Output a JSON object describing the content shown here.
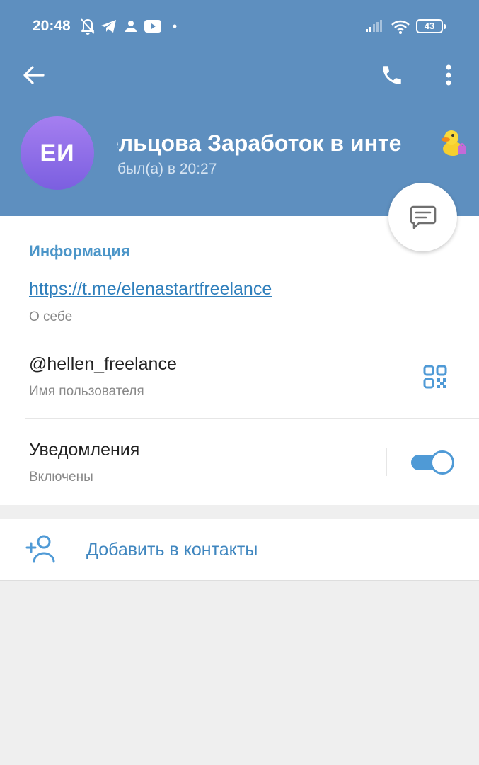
{
  "status_bar": {
    "time": "20:48",
    "battery": "43",
    "icons": [
      "bell-off-icon",
      "telegram-icon",
      "person-icon",
      "youtube-icon",
      "dot-icon",
      "signal-icon",
      "wifi-icon",
      "battery-icon"
    ]
  },
  "toolbar": {
    "back_icon": "arrow-left-icon",
    "call_icon": "phone-icon",
    "menu_icon": "more-vertical-icon"
  },
  "profile": {
    "initials": "ЕИ",
    "name": "ельцова Заработок в инте",
    "last_seen": "был(а) в 20:27",
    "emoji": "duck-emoji",
    "avatar_color": "#8f6fe8"
  },
  "fab": {
    "icon": "message-icon"
  },
  "info": {
    "section_title": "Информация",
    "bio_link": "https://t.me/elenastartfreelance",
    "bio_label": "О себе",
    "username": "@hellen_freelance",
    "username_label": "Имя пользователя",
    "notifications": "Уведомления",
    "notifications_status": "Включены",
    "notifications_enabled": true
  },
  "actions": {
    "add_contact": "Добавить в контакты"
  },
  "colors": {
    "header": "#5e8fbf",
    "accent": "#4b95c8",
    "link": "#2f7fbc",
    "toggle": "#4f9ad6"
  }
}
